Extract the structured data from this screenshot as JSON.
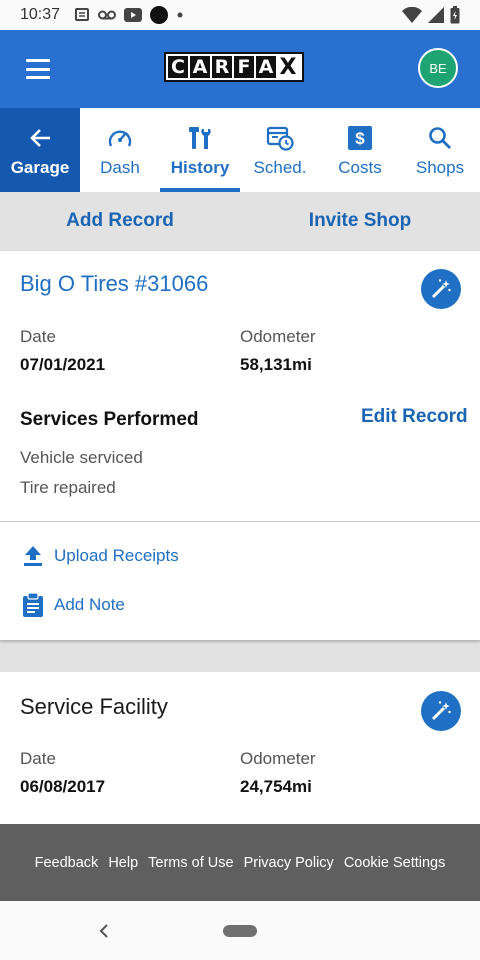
{
  "status_bar": {
    "time": "10:37"
  },
  "app_bar": {
    "logo_letters": [
      "C",
      "A",
      "R",
      "F",
      "A",
      "X"
    ],
    "avatar_initials": "BE"
  },
  "tabs": [
    {
      "label": "Garage",
      "icon": "arrow-left-icon"
    },
    {
      "label": "Dash",
      "icon": "speedometer-icon"
    },
    {
      "label": "History",
      "icon": "wrench-icon",
      "active": true
    },
    {
      "label": "Sched.",
      "icon": "calendar-clock-icon"
    },
    {
      "label": "Costs",
      "icon": "dollar-icon"
    },
    {
      "label": "Shops",
      "icon": "search-icon"
    }
  ],
  "actions": {
    "add_record": "Add Record",
    "invite_shop": "Invite Shop"
  },
  "record": {
    "title": "Big O Tires #31066",
    "date_label": "Date",
    "date": "07/01/2021",
    "odometer_label": "Odometer",
    "odometer": "58,131mi",
    "services_title": "Services Performed",
    "edit_label": "Edit Record",
    "services": [
      "Vehicle serviced",
      "Tire repaired"
    ],
    "upload_label": "Upload Receipts",
    "note_label": "Add Note"
  },
  "record2": {
    "title": "Service Facility",
    "date_label": "Date",
    "date": "06/08/2017",
    "odometer_label": "Odometer",
    "odometer": "24,754mi"
  },
  "footer": {
    "links": [
      "Feedback",
      "Help",
      "Terms of Use",
      "Privacy Policy",
      "Cookie Settings"
    ]
  },
  "colors": {
    "primary": "#2a70d0",
    "accent": "#1f6fc4",
    "garage_tab": "#1558b0",
    "avatar": "#1ea372"
  }
}
